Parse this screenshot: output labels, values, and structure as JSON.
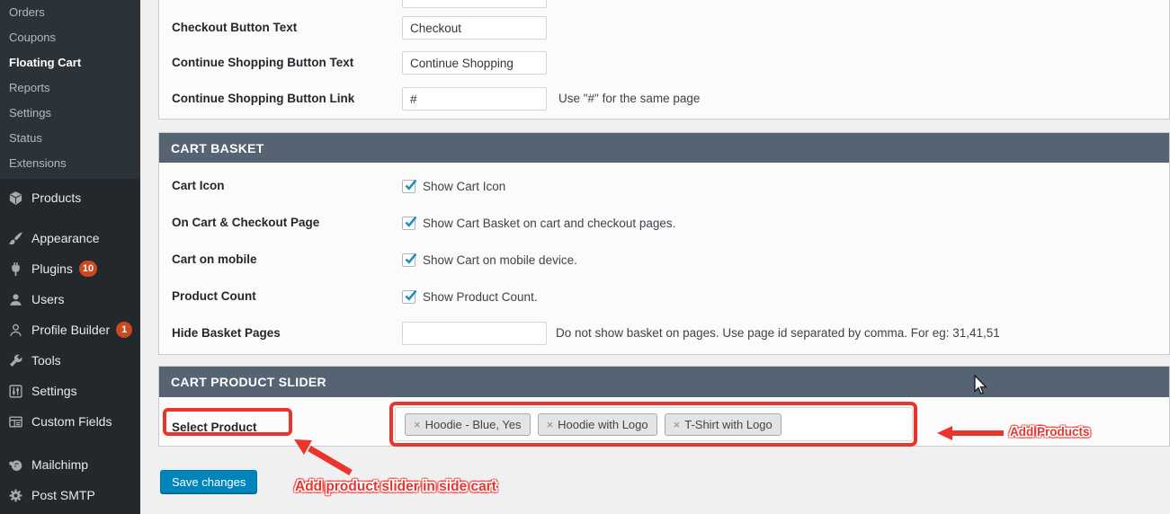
{
  "sidebar": {
    "submenu_items": [
      {
        "label": "Orders"
      },
      {
        "label": "Coupons"
      },
      {
        "label": "Floating Cart",
        "active": true
      },
      {
        "label": "Reports"
      },
      {
        "label": "Settings"
      },
      {
        "label": "Status"
      },
      {
        "label": "Extensions"
      }
    ],
    "menu_items": [
      {
        "label": "Products",
        "icon": "products-icon"
      },
      {
        "label": "Appearance",
        "icon": "appearance-icon"
      },
      {
        "label": "Plugins",
        "icon": "plugins-icon",
        "badge": "10"
      },
      {
        "label": "Users",
        "icon": "users-icon"
      },
      {
        "label": "Profile Builder",
        "icon": "profile-builder-icon",
        "badge": "1"
      },
      {
        "label": "Tools",
        "icon": "tools-icon"
      },
      {
        "label": "Settings",
        "icon": "settings-icon"
      },
      {
        "label": "Custom Fields",
        "icon": "custom-fields-icon"
      },
      {
        "label": "Mailchimp",
        "icon": "mailchimp-icon"
      },
      {
        "label": "Post SMTP",
        "icon": "post-smtp-icon"
      }
    ]
  },
  "general_section": {
    "rows": [
      {
        "label": "Checkout Button Text",
        "value": "Checkout"
      },
      {
        "label": "Continue Shopping Button Text",
        "value": "Continue Shopping"
      },
      {
        "label": "Continue Shopping Button Link",
        "value": "#",
        "hint": "Use \"#\" for the same page"
      }
    ]
  },
  "cart_basket_section": {
    "title": "CART BASKET",
    "rows": [
      {
        "label": "Cart Icon",
        "checked": true,
        "text": "Show Cart Icon"
      },
      {
        "label": "On Cart & Checkout Page",
        "checked": true,
        "text": "Show Cart Basket on cart and checkout pages."
      },
      {
        "label": "Cart on mobile",
        "checked": true,
        "text": "Show Cart on mobile device."
      },
      {
        "label": "Product Count",
        "checked": true,
        "text": "Show Product Count."
      },
      {
        "label": "Hide Basket Pages",
        "value": "",
        "hint": "Do not show basket on pages. Use page id separated by comma. For eg: 31,41,51"
      }
    ]
  },
  "slider_section": {
    "title": "CART PRODUCT SLIDER",
    "label": "Select Product",
    "tokens": [
      {
        "remove": "×",
        "label": "Hoodie - Blue, Yes"
      },
      {
        "remove": "×",
        "label": "Hoodie with Logo"
      },
      {
        "remove": "×",
        "label": "T-Shirt with Logo"
      }
    ]
  },
  "footer": {
    "save_label": "Save changes"
  },
  "annotations": {
    "select_label_note": "Add product slider in side cart",
    "field_note": "Add Products"
  },
  "colors": {
    "section_header": "#566373",
    "accent_blue": "#0085ba",
    "annotation_red": "#e8352e",
    "badge_orange": "#ca4a1f",
    "checkbox_check": "#1e8cbe",
    "sidebar_bg": "#23282d",
    "sidebar_submenu_bg": "#2c3338"
  }
}
